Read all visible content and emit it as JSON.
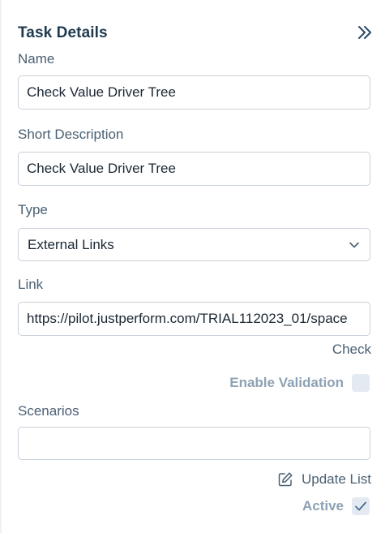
{
  "panel": {
    "title": "Task Details",
    "collapse_icon": "double-chevron-right-icon"
  },
  "fields": {
    "name": {
      "label": "Name",
      "value": "Check Value Driver Tree"
    },
    "short_description": {
      "label": "Short Description",
      "value": "Check Value Driver Tree"
    },
    "type": {
      "label": "Type",
      "value": "External Links",
      "icon": "chevron-down-icon"
    },
    "link": {
      "label": "Link",
      "value": "https://pilot.justperform.com/TRIAL112023_01/space"
    },
    "scenarios": {
      "label": "Scenarios",
      "value": ""
    }
  },
  "actions": {
    "check_label": "Check",
    "enable_validation_label": "Enable Validation",
    "enable_validation_checked": false,
    "update_list_label": "Update List",
    "update_list_icon": "edit-icon",
    "active_label": "Active",
    "active_checked": true
  },
  "colors": {
    "heading": "#1f3a4f",
    "label": "#4a6073",
    "muted": "#8da2b5",
    "checkbox_bg": "#e3eaf1",
    "border": "#c9d1d9"
  }
}
